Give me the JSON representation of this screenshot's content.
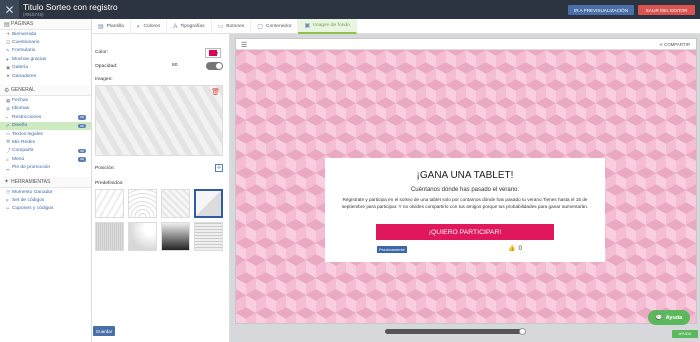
{
  "header": {
    "title": "Titulo Sorteo con registro",
    "subtitle": "(#915749)",
    "close_icon": "x-icon",
    "preview_label": "IR A PREVISUALIZACIÓN",
    "exit_label": "SALIR DEL EDITOR"
  },
  "sidebar": {
    "sections": [
      {
        "label": "PÁGINAS",
        "icon": "pages-icon",
        "items": [
          {
            "label": "Bienvenida",
            "icon": "arrow-icon"
          },
          {
            "label": "Cuestionario",
            "icon": "list-icon"
          },
          {
            "label": "Formulario",
            "icon": "form-icon"
          },
          {
            "label": "Muchas gracias",
            "icon": "heart-icon"
          },
          {
            "label": "Galería",
            "icon": "gallery-icon"
          },
          {
            "label": "Ganadores",
            "icon": "trophy-icon"
          }
        ]
      },
      {
        "label": "GENERAL",
        "icon": "gear-icon",
        "items": [
          {
            "label": "Fechas",
            "icon": "calendar-icon"
          },
          {
            "label": "Idiomas",
            "icon": "language-icon"
          },
          {
            "label": "Restricciones",
            "icon": "lock-icon",
            "badge": "ok"
          },
          {
            "label": "Diseño",
            "icon": "brush-icon",
            "badge": "ok",
            "active": true
          },
          {
            "label": "Textos legales",
            "icon": "doc-icon"
          },
          {
            "label": "Mis Redes",
            "icon": "network-icon"
          },
          {
            "label": "Compartir",
            "icon": "share-icon",
            "badge": "ok"
          },
          {
            "label": "Menú",
            "icon": "menu-icon",
            "badge": "ok"
          },
          {
            "label": "Pie de promoción",
            "icon": "footer-icon"
          }
        ]
      },
      {
        "label": "HERRAMIENTAS",
        "icon": "wrench-icon",
        "items": [
          {
            "label": "Momento Ganador",
            "icon": "clock-icon"
          },
          {
            "label": "Set de códigos",
            "icon": "code-icon"
          },
          {
            "label": "Cupones y códigos",
            "icon": "coupon-icon"
          }
        ]
      }
    ]
  },
  "tabs": [
    {
      "label": "Plantilla",
      "icon": "template-icon"
    },
    {
      "label": "Colores",
      "icon": "palette-icon"
    },
    {
      "label": "Tipografías",
      "icon": "font-icon"
    },
    {
      "label": "Botones",
      "icon": "button-icon"
    },
    {
      "label": "Contenedor",
      "icon": "container-icon"
    },
    {
      "label": "Imagen de fondo",
      "icon": "image-icon",
      "active": true
    }
  ],
  "panel": {
    "color_label": "Color:",
    "color_value": "#e0005a",
    "opacity_label": "Opacidad:",
    "opacity_value": "80",
    "image_label": "Imagen:",
    "position_label": "Posición:",
    "predefined_label": "Predefinidos:",
    "save_label": "Guardar"
  },
  "preview": {
    "share_label": "COMPARTIR",
    "heading": "¡GANA UNA TABLET!",
    "lead": "Cuéntanos dónde has pasado el verano.",
    "description": "Regístrate y participa en el sorteo de una tablet solo por contarnos dónde has pasado tu verano.Tienes hasta el 15 de septiembre para participar. Y no olvides compartirlo con tus amigos porque tus probabilidades para ganar aumentarán.",
    "cta_label": "¡QUIERO PARTICIPAR!",
    "soon_label": "Próximamente",
    "likes": "0"
  },
  "help": {
    "label": "Ayuda",
    "small_label": "AYUDA"
  },
  "colors": {
    "accent": "#e0175d",
    "topbar": "#2b3440",
    "active_tab": "#8bc34a",
    "link": "#3a6aa5"
  }
}
